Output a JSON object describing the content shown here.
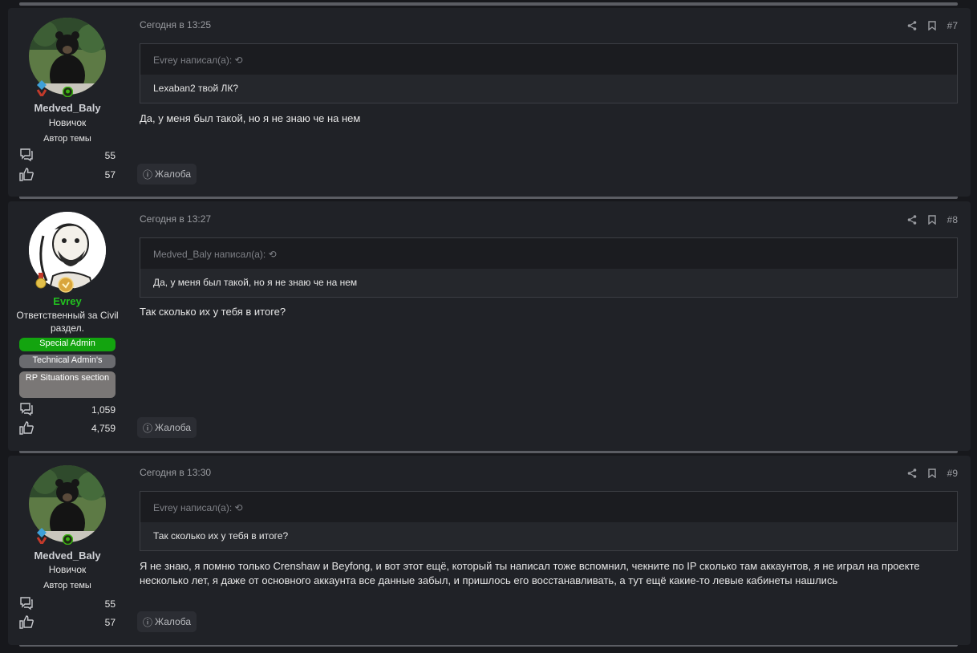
{
  "posts": [
    {
      "author": "Medved_Baly",
      "author_color": "#cfd1d6",
      "user_title": "Новичок",
      "banner": "Автор темы",
      "messages_count": "55",
      "reactions_count": "57",
      "date": "Сегодня в 13:25",
      "number": "#7",
      "quote_author": "Evrey написал(а):",
      "quote_text": "Lexaban2 твой ЛК?",
      "message": "Да, у меня был такой, но я не знаю че на нем",
      "report_label": "Жалоба"
    },
    {
      "author": "Evrey",
      "author_color": "#22c21f",
      "user_title": "Ответственный за Civil раздел.",
      "banners": [
        {
          "label": "Special Admin",
          "color": "#13a40f"
        },
        {
          "label": "Technical Admin's",
          "color": "#6a6b6f"
        },
        {
          "label": "RP Situations section",
          "color": "#7a7776"
        }
      ],
      "messages_count": "1,059",
      "reactions_count": "4,759",
      "date": "Сегодня в 13:27",
      "number": "#8",
      "quote_author": "Medved_Baly написал(а):",
      "quote_text": "Да, у меня был такой, но я не знаю че на нем",
      "message": "Так сколько их у тебя в итоге?",
      "report_label": "Жалоба"
    },
    {
      "author": "Medved_Baly",
      "author_color": "#cfd1d6",
      "user_title": "Новичок",
      "banner": "Автор темы",
      "messages_count": "55",
      "reactions_count": "57",
      "date": "Сегодня в 13:30",
      "number": "#9",
      "quote_author": "Evrey написал(а):",
      "quote_text": "Так сколько их у тебя в итоге?",
      "message": "Я не знаю, я помню только Crenshaw и Beyfong, и вот этот ещё, который ты написал тоже вспомнил, чекните по IP сколько там аккаунтов, я не играл на проекте несколько лет, я даже от основного аккаунта все данные забыл, и пришлось его восстанавливать, а тут ещё какие-то левые кабинеты нашлись",
      "report_label": "Жалоба"
    }
  ]
}
